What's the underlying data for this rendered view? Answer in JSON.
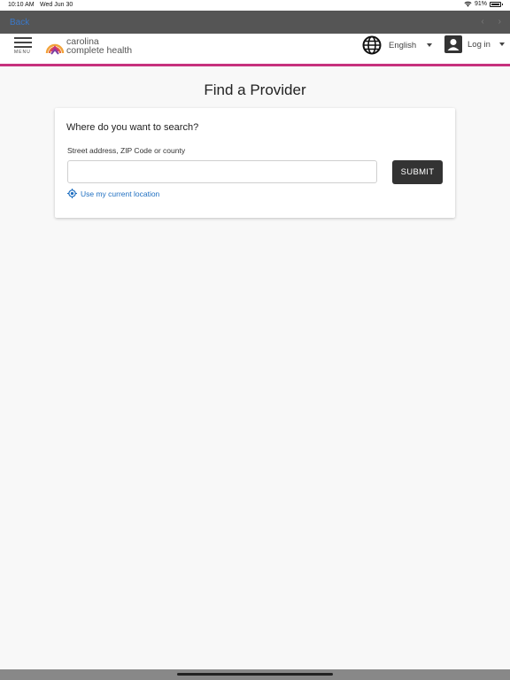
{
  "status_bar": {
    "time": "10:10 AM",
    "date": "Wed Jun 30",
    "battery": "91%",
    "battery_level": 0.91
  },
  "nav": {
    "back_label": "Back",
    "prev_icon": "chevron-left-icon",
    "next_icon": "chevron-right-icon"
  },
  "header": {
    "menu_label": "MENU",
    "logo_line1": "carolina",
    "logo_line2": "complete health",
    "language_label": "English",
    "login_label": "Log in",
    "accent_color": "#c6317d"
  },
  "page": {
    "title": "Find a Provider"
  },
  "search_card": {
    "heading": "Where do you want to search?",
    "field_label": "Street address, ZIP Code or county",
    "input_value": "",
    "input_placeholder": "",
    "submit_label": "SUBMIT",
    "location_link": "Use my current location"
  }
}
